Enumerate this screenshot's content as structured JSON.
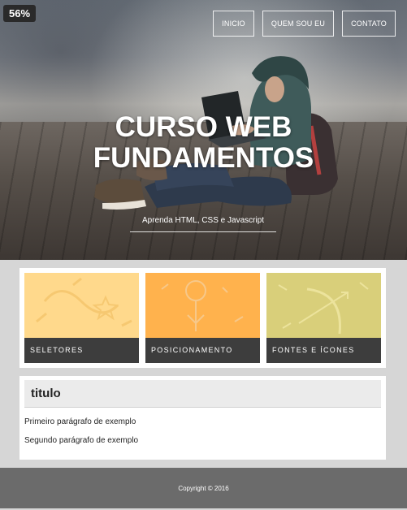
{
  "badge": "56%",
  "nav": [
    {
      "label": "INICIO"
    },
    {
      "label": "QUEM SOU EU"
    },
    {
      "label": "CONTATO"
    }
  ],
  "hero": {
    "title_line1": "CURSO WEB",
    "title_line2": "FUNDAMENTOS",
    "subtitle": "Aprenda HTML, CSS e Javascript"
  },
  "cards": [
    {
      "label": "SELETORES",
      "color": "#ffd98c",
      "icon": "star-icon"
    },
    {
      "label": "POSICIONAMENTO",
      "color": "#ffb24d",
      "icon": "pin-icon"
    },
    {
      "label": "FONTES E ÍCONES",
      "color": "#d9cf7a",
      "icon": "bow-arrow-icon"
    }
  ],
  "content": {
    "title": "titulo",
    "paragraphs": [
      "Primeiro parágrafo de exemplo",
      "Segundo parágrafo de exemplo"
    ]
  },
  "footer": {
    "copyright": "Copyright © 2016"
  }
}
